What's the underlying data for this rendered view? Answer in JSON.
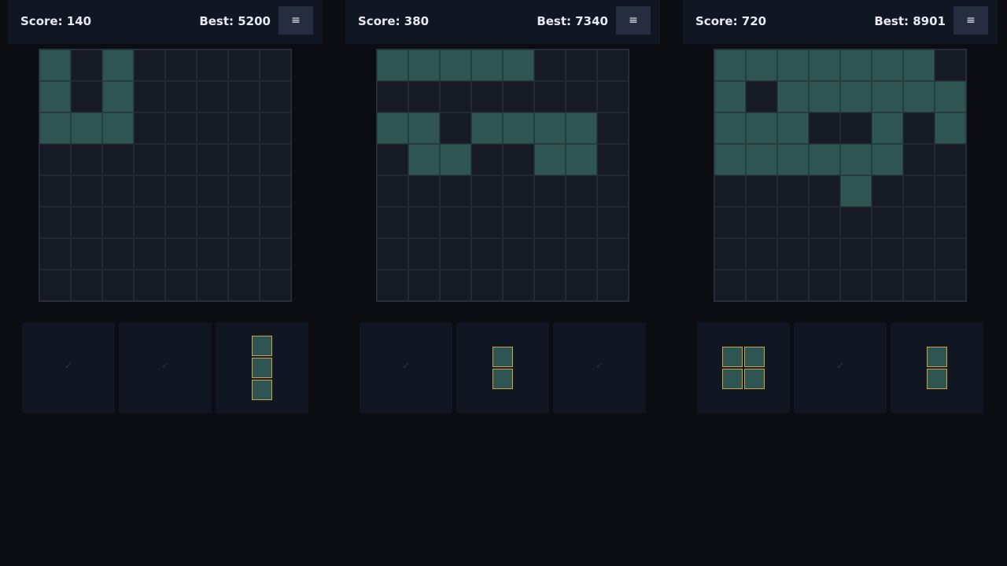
{
  "colors": {
    "background": "#0b0d12",
    "header": "#111722",
    "board_empty": "#161a24",
    "block_fill": "#2f5553",
    "piece_border": "#c9a635",
    "menu_button": "#262d40",
    "text": "#e6e9ef"
  },
  "menu_icon": "hamburger-icon",
  "games": [
    {
      "score_label": "Score: 140",
      "best_label": "Best: 5200",
      "menu_label": "≡",
      "grid": [
        "10100000",
        "10100000",
        "11100000",
        "00000000",
        "00000000",
        "00000000",
        "00000000",
        "00000000"
      ],
      "pieces": [
        {
          "placed": true,
          "mark": "✓"
        },
        {
          "placed": true,
          "mark": "✓"
        },
        {
          "placed": false,
          "mark": "",
          "shape": [
            "1",
            "1",
            "1"
          ]
        }
      ]
    },
    {
      "score_label": "Score: 380",
      "best_label": "Best: 7340",
      "menu_label": "≡",
      "grid": [
        "11111000",
        "00000000",
        "11011110",
        "01100110",
        "00000000",
        "00000000",
        "00000000",
        "00000000"
      ],
      "pieces": [
        {
          "placed": true,
          "mark": "✓"
        },
        {
          "placed": false,
          "mark": "",
          "shape": [
            "1",
            "1"
          ]
        },
        {
          "placed": true,
          "mark": "✓"
        }
      ]
    },
    {
      "score_label": "Score: 720",
      "best_label": "Best: 8901",
      "menu_label": "≡",
      "grid": [
        "11111110",
        "10111111",
        "11100101",
        "11111100",
        "00001000",
        "00000000",
        "00000000",
        "00000000"
      ],
      "pieces": [
        {
          "placed": false,
          "mark": "",
          "shape": [
            "11",
            "11"
          ]
        },
        {
          "placed": true,
          "mark": "✓"
        },
        {
          "placed": false,
          "mark": "",
          "shape": [
            "1",
            "1"
          ]
        }
      ]
    }
  ]
}
